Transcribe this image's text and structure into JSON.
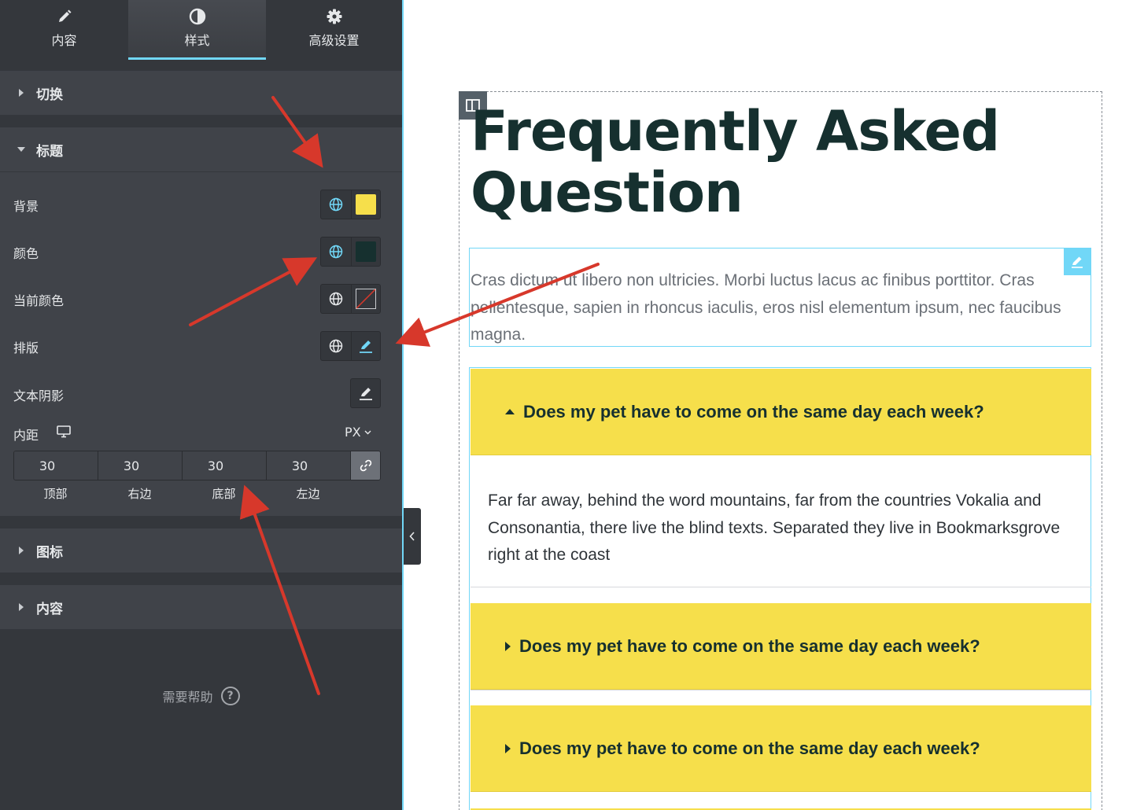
{
  "panel": {
    "tabs": [
      {
        "label": "内容",
        "icon": "pencil-icon"
      },
      {
        "label": "样式",
        "icon": "contrast-icon",
        "active": true
      },
      {
        "label": "高级设置",
        "icon": "gear-icon"
      }
    ],
    "sections": {
      "toggle": "切换",
      "title": "标题",
      "icon": "图标",
      "content": "内容"
    },
    "controls": {
      "background": {
        "label": "背景",
        "color": "#f6df4b"
      },
      "color": {
        "label": "颜色",
        "color": "#16302f"
      },
      "active_color": {
        "label": "当前颜色"
      },
      "typography": {
        "label": "排版"
      },
      "text_shadow": {
        "label": "文本阴影"
      },
      "padding": {
        "label": "内距",
        "unit": "PX",
        "top": "30",
        "right": "30",
        "bottom": "30",
        "left": "30",
        "top_label": "顶部",
        "right_label": "右边",
        "bottom_label": "底部",
        "left_label": "左边"
      }
    },
    "help": "需要帮助",
    "accent": "#71d7f7"
  },
  "preview": {
    "title": "Frequently Asked Question",
    "intro": "Cras dictum ut libero non ultricies. Morbi luctus lacus ac finibus porttitor. Cras pellentesque, sapien in rhoncus iaculis, eros nisl elementum ipsum, nec faucibus magna.",
    "faqs": [
      {
        "question": "Does my pet have to come on the same day each week?",
        "expanded": true,
        "answer": "Far far away, behind the word mountains, far from the countries Vokalia and Consonantia, there live the blind texts. Separated they live in Bookmarksgrove right at the coast"
      },
      {
        "question": "Does my pet have to come on the same day each week?",
        "expanded": false
      },
      {
        "question": "Does my pet have to come on the same day each week?",
        "expanded": false
      }
    ],
    "header_bg": "#f6df4b",
    "title_color": "#16302f"
  },
  "annotation_color": "#d7382b"
}
